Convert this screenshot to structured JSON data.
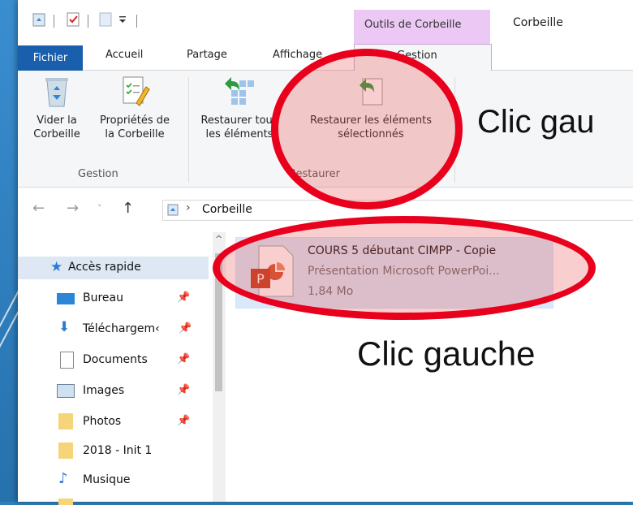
{
  "window": {
    "contextual_tab_group": "Outils de Corbeille",
    "title": "Corbeille"
  },
  "tabs": {
    "file": "Fichier",
    "home": "Accueil",
    "share": "Partage",
    "view": "Affichage",
    "manage": "Gestion"
  },
  "ribbon": {
    "empty_bin_line1": "Vider la",
    "empty_bin_line2": "Corbeille",
    "properties_line1": "Propriétés de",
    "properties_line2": "la Corbeille",
    "group_manage": "Gestion",
    "restore_all_line1": "Restaurer tous",
    "restore_all_line2": "les éléments",
    "restore_selected_line1": "Restaurer les éléments",
    "restore_selected_line2": "sélectionnés",
    "group_restore": "Restaurer"
  },
  "address": {
    "separator": "›",
    "location": "Corbeille",
    "collapse_glyph": "^"
  },
  "nav_pane": {
    "quick_access": "Accès rapide",
    "items": [
      {
        "label": "Bureau",
        "pinned": true
      },
      {
        "label": "Téléchargem‹",
        "pinned": true
      },
      {
        "label": "Documents",
        "pinned": true
      },
      {
        "label": "Images",
        "pinned": true
      },
      {
        "label": "Photos",
        "pinned": true
      },
      {
        "label": "2018 - Init 1",
        "pinned": false
      },
      {
        "label": "Musique",
        "pinned": false
      }
    ]
  },
  "file": {
    "name": "COURS 5 débutant CIMPP - Copie",
    "type": "Présentation Microsoft PowerPoi...",
    "size": "1,84 Mo"
  },
  "annotations": {
    "top": "Clic gau",
    "middle": "Clic gauche"
  },
  "colors": {
    "accent_file_tab": "#1a5fad",
    "contextual_tab": "#ecc8f5",
    "selection": "#d9e9fb",
    "annotation_red": "#e8001c"
  }
}
